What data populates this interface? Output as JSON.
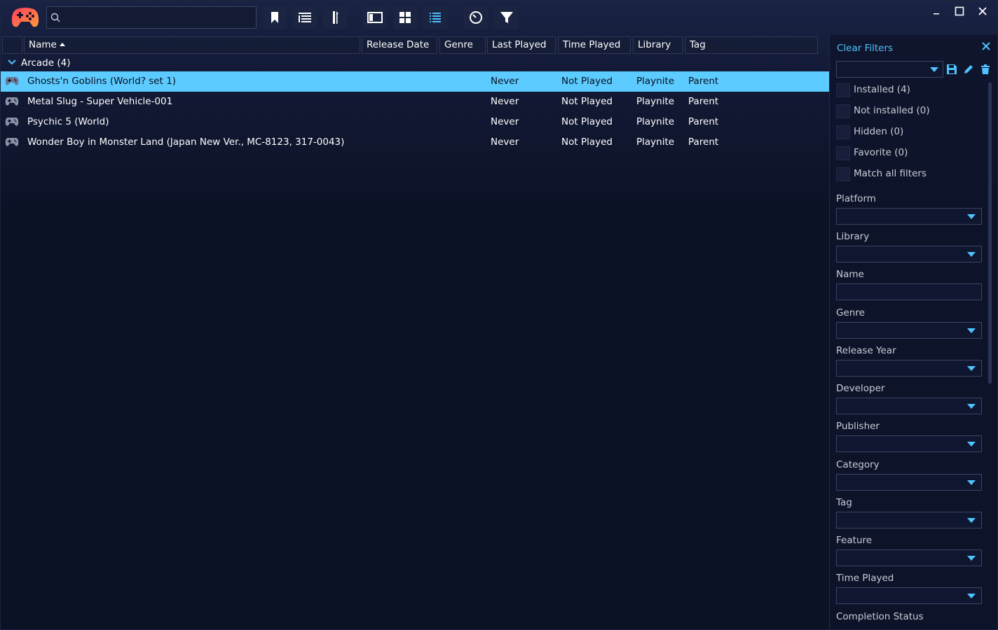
{
  "search": {
    "value": "",
    "placeholder": ""
  },
  "toolbar": {
    "buttons": [
      "bookmark-icon",
      "grouping-icon",
      "sort-icon",
      "details-view-icon",
      "grid-view-icon",
      "list-view-icon",
      "clock-icon",
      "filter-icon"
    ]
  },
  "window": {
    "minimize": "—",
    "maximize": "☐",
    "close": "✕"
  },
  "columns": [
    "Name",
    "Release Date",
    "Genre",
    "Last Played",
    "Time Played",
    "Library",
    "Tag"
  ],
  "group": {
    "label": "Arcade (4)"
  },
  "games": [
    {
      "name": "Ghosts'n Goblins (World? set 1)",
      "last_played": "Never",
      "time_played": "Not Played",
      "library": "Playnite",
      "tag": "Parent",
      "selected": true
    },
    {
      "name": "Metal Slug - Super Vehicle-001",
      "last_played": "Never",
      "time_played": "Not Played",
      "library": "Playnite",
      "tag": "Parent",
      "selected": false
    },
    {
      "name": "Psychic 5 (World)",
      "last_played": "Never",
      "time_played": "Not Played",
      "library": "Playnite",
      "tag": "Parent",
      "selected": false
    },
    {
      "name": "Wonder Boy in Monster Land (Japan New Ver., MC-8123, 317-0043)",
      "last_played": "Never",
      "time_played": "Not Played",
      "library": "Playnite",
      "tag": "Parent",
      "selected": false
    }
  ],
  "filters": {
    "clear_label": "Clear Filters",
    "checkboxes": [
      "Installed (4)",
      "Not installed (0)",
      "Hidden (0)",
      "Favorite (0)",
      "Match all filters"
    ],
    "fields": [
      "Platform",
      "Library",
      "Name",
      "Genre",
      "Release Year",
      "Developer",
      "Publisher",
      "Category",
      "Tag",
      "Feature",
      "Time Played",
      "Completion Status"
    ]
  },
  "colors": {
    "accent": "#4fc3ff",
    "selected_row": "#5ccbff",
    "background": "#0c1226"
  }
}
